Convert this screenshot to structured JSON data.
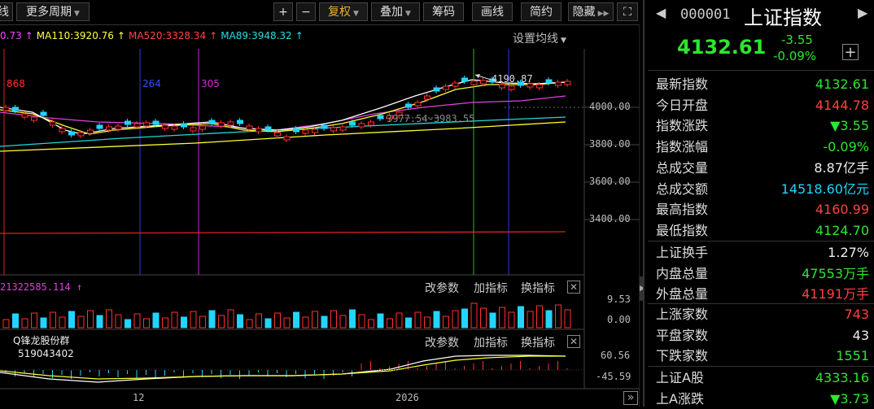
{
  "toolbar": {
    "left_stub": "线",
    "more_period": "更多周期",
    "plus": "+",
    "minus": "−",
    "fuquan": "复权",
    "diejia": "叠加",
    "chouma": "筹码",
    "huaxian": "画线",
    "jianyue": "简约",
    "yincang": "隐藏",
    "expand": "⛶"
  },
  "ma_legend": [
    {
      "text": "0.73",
      "color": "#ff44ff"
    },
    {
      "text": "↑",
      "color": "#ff44ff"
    },
    {
      "text": "MA110:3920.76",
      "color": "#ffff44"
    },
    {
      "text": "↑",
      "color": "#ffff44"
    },
    {
      "text": "MA520:3328.34",
      "color": "#ff4444"
    },
    {
      "text": "↑",
      "color": "#ff4444"
    },
    {
      "text": "MA89:3948.32",
      "color": "#22e0e0"
    },
    {
      "text": "↑",
      "color": "#22e0e0"
    }
  ],
  "settings_ma": "设置均线",
  "price_axis": [
    "4000.00",
    "3800.00",
    "3600.00",
    "3400.00"
  ],
  "vline_labels": [
    {
      "text": "868",
      "color": "#ff3030"
    },
    {
      "text": "264",
      "color": "#3050ff"
    },
    {
      "text": "305",
      "color": "#e020e0"
    }
  ],
  "annotations": {
    "high": "4190.87",
    "range": "3977.54-3983.55"
  },
  "volume_panel": {
    "label": "21322585.114",
    "arrow": "↑",
    "axis_top": "9.53",
    "axis_bottom": "0.00",
    "btn_params": "改参数",
    "btn_add": "加指标",
    "btn_switch": "换指标",
    "close": "✕"
  },
  "macd_panel": {
    "axis_top": "60.56",
    "axis_bottom": "-45.59",
    "btn_params": "改参数",
    "btn_add": "加指标",
    "btn_switch": "换指标",
    "close": "✕"
  },
  "watermark": {
    "line1": "Q锋龙股份群",
    "line2": "519043402"
  },
  "time_axis": [
    "12",
    "2026"
  ],
  "scroll_btn": "»",
  "right_panel": {
    "code": "000001",
    "name": "上证指数",
    "price": "4132.61",
    "change": "-3.55",
    "change_pct": "-0.09%",
    "plus": "+",
    "rows_a": [
      {
        "label": "最新指数",
        "value": "4132.61",
        "color": "green"
      },
      {
        "label": "今日开盘",
        "value": "4144.78",
        "color": "red"
      },
      {
        "label": "指数涨跌",
        "value": "▼3.55",
        "color": "green"
      },
      {
        "label": "指数涨幅",
        "value": "-0.09%",
        "color": "green"
      },
      {
        "label": "总成交量",
        "value": "8.87亿手",
        "color": "white"
      },
      {
        "label": "总成交额",
        "value": "14518.60亿元",
        "color": "cyan"
      },
      {
        "label": "最高指数",
        "value": "4160.99",
        "color": "red"
      },
      {
        "label": "最低指数",
        "value": "4124.70",
        "color": "green"
      }
    ],
    "rows_b": [
      {
        "label": "上证换手",
        "value": "1.27%",
        "color": "white"
      },
      {
        "label": "内盘总量",
        "value": "47553万手",
        "color": "green"
      },
      {
        "label": "外盘总量",
        "value": "41191万手",
        "color": "red"
      }
    ],
    "rows_c": [
      {
        "label": "上涨家数",
        "value": "743",
        "color": "red"
      },
      {
        "label": "平盘家数",
        "value": "43",
        "color": "white"
      },
      {
        "label": "下跌家数",
        "value": "1551",
        "color": "green"
      }
    ],
    "rows_d": [
      {
        "label": "上证A股",
        "value": "4333.16",
        "color": "green"
      },
      {
        "label": "上A涨跌",
        "value": "▼3.73",
        "color": "green"
      }
    ]
  },
  "colors": {
    "up": "#ff3030",
    "down": "#22d4ff",
    "bg": "#000000"
  }
}
